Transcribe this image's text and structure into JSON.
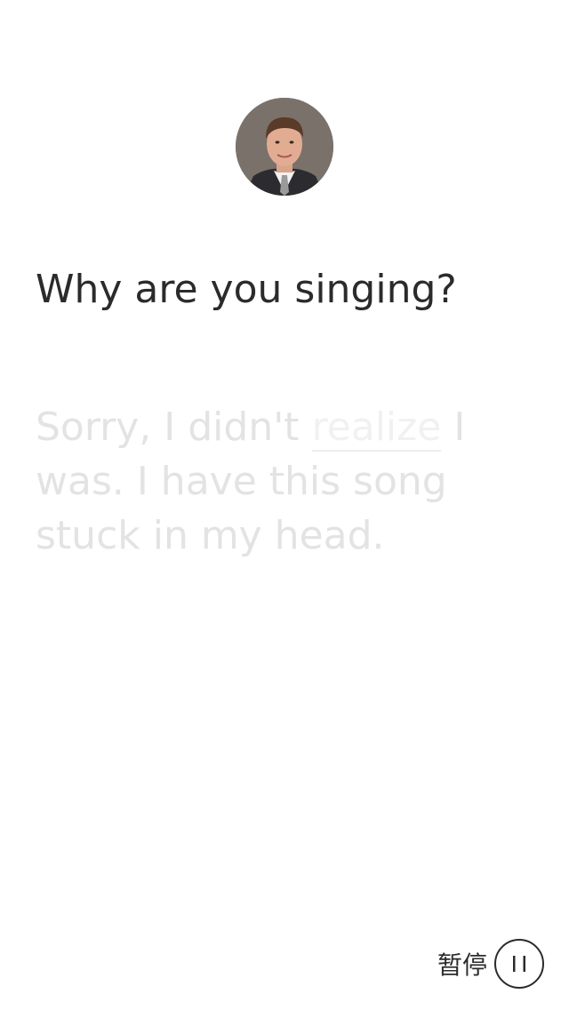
{
  "question": {
    "text": "Why are you singing?"
  },
  "answer": {
    "part1": "Sorry, I didn't ",
    "highlight": "realize",
    "part2": " I was. I have this song stuck in my head."
  },
  "controls": {
    "pause_label": "暂停",
    "pause_icon": "pause-icon"
  },
  "colors": {
    "text_dark": "#2b2b2b",
    "text_faded": "#e3e3e3",
    "background": "#ffffff"
  }
}
